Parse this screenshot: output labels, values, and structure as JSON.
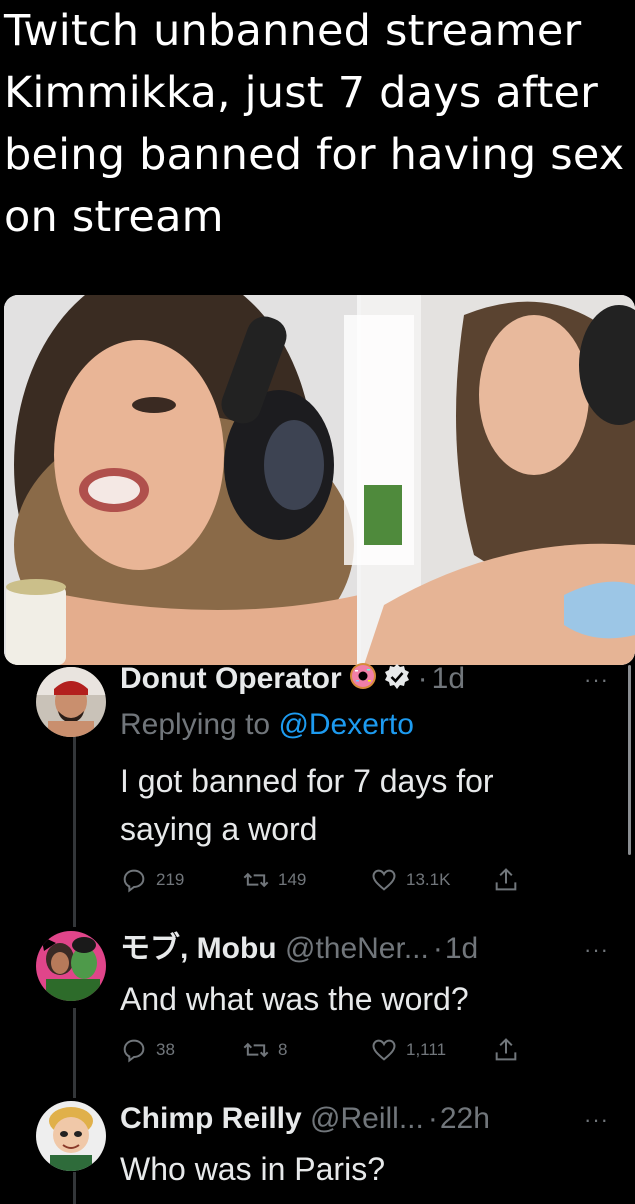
{
  "headline": "Twitch unbanned streamer Kimmikka, just 7 days after being banned for having sex on stream",
  "tweets": [
    {
      "name": "Donut Operator",
      "time": "1d",
      "replying_prefix": "Replying to",
      "replying_to": "@Dexerto",
      "text_lines": [
        "I got banned for 7 days for",
        "saying a word"
      ],
      "replies": "219",
      "retweets": "149",
      "likes": "13.1K",
      "verified": true,
      "badge_icon": "donut-icon"
    },
    {
      "name": "モブ, Mobu",
      "handle": "@theNer...",
      "time": "1d",
      "text": "And what was the word?",
      "replies": "38",
      "retweets": "8",
      "likes": "1,111"
    },
    {
      "name": "Chimp Reilly",
      "handle": "@Reill...",
      "time": "22h",
      "text": "Who was in Paris?"
    }
  ],
  "dot": "·",
  "more": "···",
  "colors": {
    "background": "#000000",
    "text": "#e7e9ea",
    "muted": "#71767b",
    "link": "#1d9bf0",
    "thread_line": "#333639"
  }
}
